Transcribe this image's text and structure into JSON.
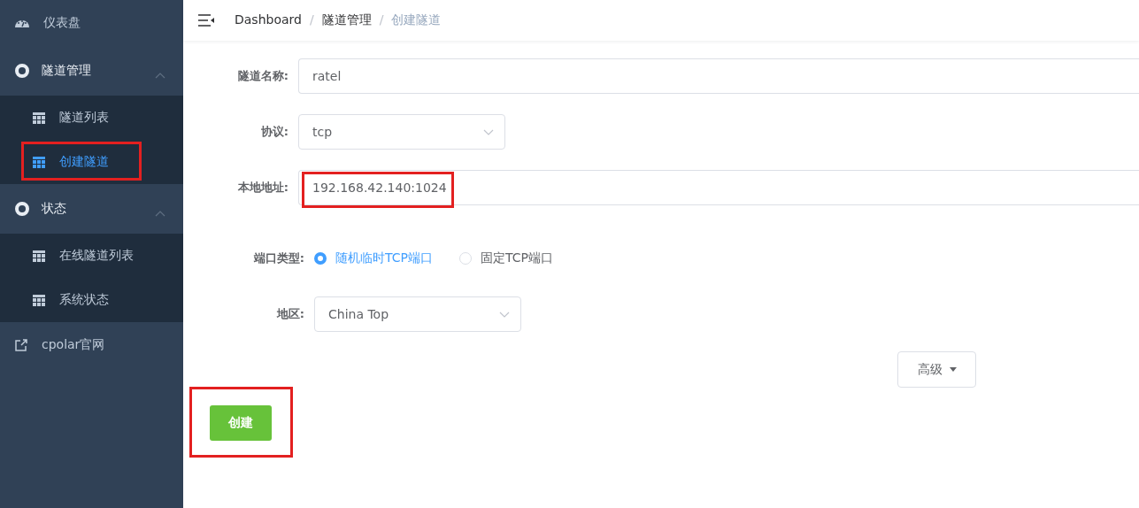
{
  "sidebar": {
    "items": [
      {
        "kind": "link",
        "label": "仪表盘"
      },
      {
        "kind": "group",
        "label": "隧道管理",
        "expanded": true,
        "children": [
          {
            "label": "隧道列表",
            "selected": false,
            "annotated": false
          },
          {
            "label": "创建隧道",
            "selected": true,
            "annotated": true
          }
        ]
      },
      {
        "kind": "group",
        "label": "状态",
        "expanded": true,
        "children": [
          {
            "label": "在线隧道列表",
            "selected": false,
            "annotated": false
          },
          {
            "label": "系统状态",
            "selected": false,
            "annotated": false
          }
        ]
      },
      {
        "kind": "external",
        "label": "cpolar官网"
      }
    ]
  },
  "breadcrumb_separator": "/",
  "breadcrumbs": [
    {
      "label": "Dashboard",
      "current": false
    },
    {
      "label": "隧道管理",
      "current": false
    },
    {
      "label": "创建隧道",
      "current": true
    }
  ],
  "form": {
    "fields": [
      {
        "kind": "text",
        "label": "隧道名称:",
        "value": "ratel",
        "annotated": false
      },
      {
        "kind": "select",
        "label": "协议:",
        "value": "tcp",
        "annotated": false
      },
      {
        "kind": "text",
        "label": "本地地址:",
        "value": "192.168.42.140:1024",
        "annotated": true
      }
    ],
    "port_type": {
      "label": "端口类型:",
      "options": [
        {
          "label": "随机临时TCP端口",
          "selected": true
        },
        {
          "label": "固定TCP端口",
          "selected": false
        }
      ]
    },
    "region": {
      "label": "地区:",
      "value": "China Top"
    },
    "advanced_button": "高级",
    "create_button": {
      "label": "创建",
      "annotated": true
    }
  }
}
